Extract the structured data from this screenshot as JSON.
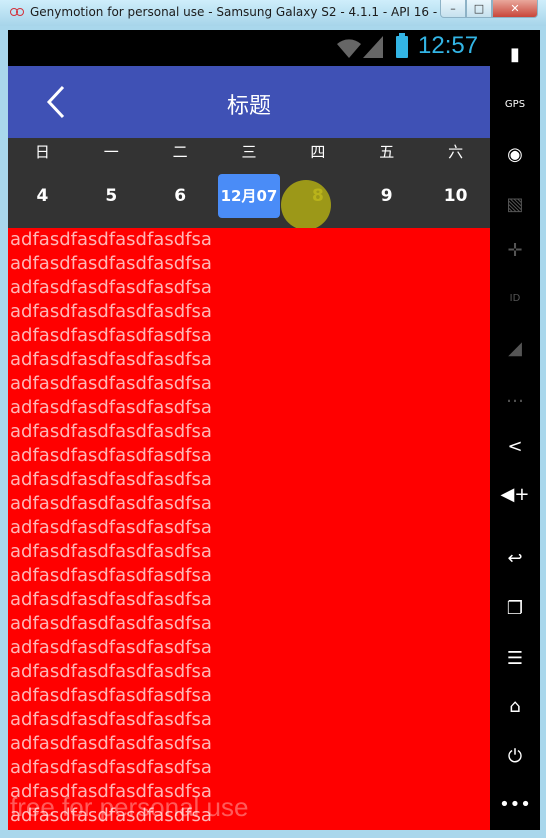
{
  "window": {
    "title": "Genymotion for personal use - Samsung Galaxy S2 - 4.1.1 - API 16 - ...",
    "min_label": "–",
    "max_label": "□",
    "close_label": "✕"
  },
  "status_bar": {
    "time": "12:57"
  },
  "app_bar": {
    "title": "标题",
    "back_icon": "chevron-left-icon"
  },
  "calendar": {
    "weekdays": [
      "日",
      "一",
      "二",
      "三",
      "四",
      "五",
      "六"
    ],
    "days": [
      "4",
      "5",
      "6",
      "12月07",
      "8",
      "9",
      "10"
    ],
    "selected_index": 3,
    "highlight_color": "#4a8cf7"
  },
  "content": {
    "background": "#ff0000",
    "lines": [
      "adfasdfasdfasdfasdfsa",
      "adfasdfasdfasdfasdfsa",
      "adfasdfasdfasdfasdfsa",
      "adfasdfasdfasdfasdfsa",
      "adfasdfasdfasdfasdfsa",
      "adfasdfasdfasdfasdfsa",
      "adfasdfasdfasdfasdfsa",
      "adfasdfasdfasdfasdfsa",
      "adfasdfasdfasdfasdfsa",
      "adfasdfasdfasdfasdfsa",
      "adfasdfasdfasdfasdfsa",
      "adfasdfasdfasdfasdfsa",
      "adfasdfasdfasdfasdfsa",
      "adfasdfasdfasdfasdfsa",
      "adfasdfasdfasdfasdfsa",
      "adfasdfasdfasdfasdfsa",
      "adfasdfasdfasdfasdfsa",
      "adfasdfasdfasdfasdfsa",
      "adfasdfasdfasdfasdfsa",
      "adfasdfasdfasdfasdfsa",
      "adfasdfasdfasdfasdfsa",
      "adfasdfasdfasdfasdfsa",
      "adfasdfasdfasdfasdfsa",
      "adfasdfasdfasdfasdfsa",
      "adfasdfasdfasdfasdfsa"
    ],
    "watermark": "free for personal use"
  },
  "sidebar": {
    "buttons": [
      {
        "name": "battery-icon",
        "glyph": "▮"
      },
      {
        "name": "gps-icon",
        "glyph": "GPS"
      },
      {
        "name": "webcam-icon",
        "glyph": "◉"
      },
      {
        "name": "clapper-icon",
        "glyph": "▧"
      },
      {
        "name": "dpad-icon",
        "glyph": "✛"
      },
      {
        "name": "id-icon",
        "glyph": "ID"
      },
      {
        "name": "rss-icon",
        "glyph": "◢"
      },
      {
        "name": "sms-icon",
        "glyph": "…"
      },
      {
        "name": "share-icon",
        "glyph": "<"
      },
      {
        "name": "volume-up-icon",
        "glyph": "◀+"
      },
      {
        "name": "back-icon",
        "glyph": "↩"
      },
      {
        "name": "recent-apps-icon",
        "glyph": "❐"
      },
      {
        "name": "menu-icon",
        "glyph": "☰"
      },
      {
        "name": "home-icon",
        "glyph": "⌂"
      },
      {
        "name": "power-icon",
        "glyph": "⏻"
      },
      {
        "name": "more-icon",
        "glyph": "•••"
      }
    ]
  }
}
